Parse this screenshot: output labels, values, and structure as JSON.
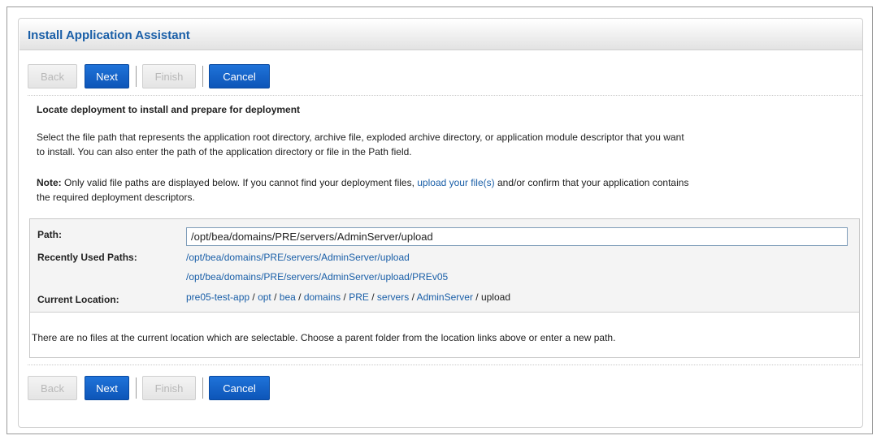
{
  "header": {
    "title": "Install Application Assistant"
  },
  "buttons": {
    "back": "Back",
    "next": "Next",
    "finish": "Finish",
    "cancel": "Cancel"
  },
  "content": {
    "heading": "Locate deployment to install and prepare for deployment",
    "description_line1": "Select the file path that represents the application root directory, archive file, exploded archive directory, or application module descriptor that you want",
    "description_line2": "to install. You can also enter the path of the application directory or file in the Path field.",
    "note_label": "Note:",
    "note_text_before": " Only valid file paths are displayed below. If you cannot find your deployment files, ",
    "note_link": "upload your file(s)",
    "note_text_after": " and/or confirm that your application contains",
    "note_line2": "the required deployment descriptors."
  },
  "path_box": {
    "path_label": "Path:",
    "path_value": "/opt/bea/domains/PRE/servers/AdminServer/upload",
    "recent_label": "Recently Used Paths:",
    "recent_paths": [
      "/opt/bea/domains/PRE/servers/AdminServer/upload",
      "/opt/bea/domains/PRE/servers/AdminServer/upload/PREv05"
    ],
    "location_label": "Current Location:",
    "location_crumbs": [
      "pre05-test-app",
      "opt",
      "bea",
      "domains",
      "PRE",
      "servers",
      "AdminServer"
    ],
    "location_current": "upload",
    "separator": " / ",
    "empty_message": "There are no files at the current location which are selectable. Choose a parent folder from the location links above or enter a new path."
  },
  "colors": {
    "link": "#1a5fa8",
    "primary_button": "#1262c9",
    "title": "#1a5fa8"
  }
}
